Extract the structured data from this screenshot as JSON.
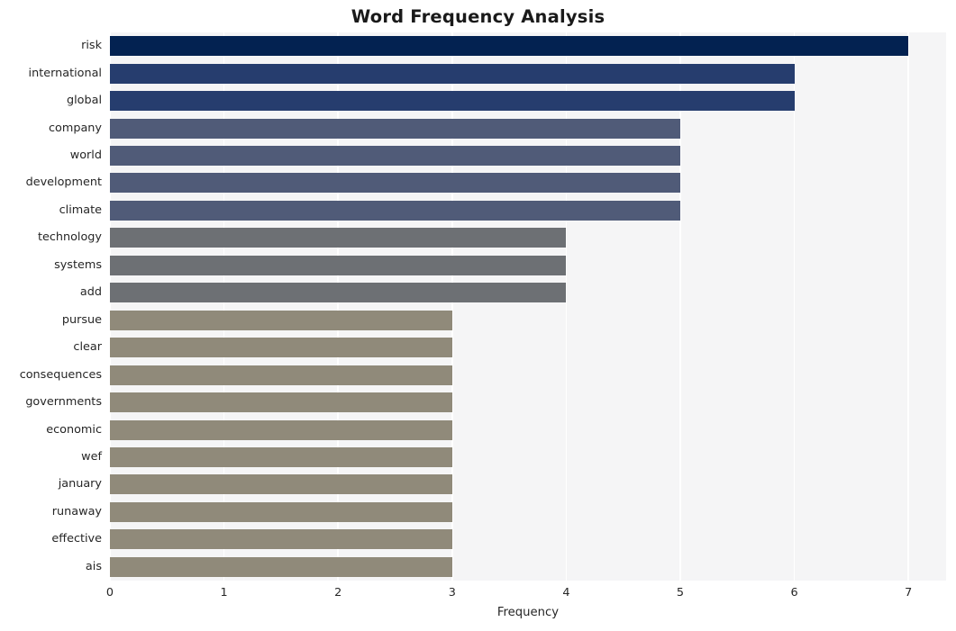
{
  "chart_data": {
    "type": "bar",
    "orientation": "horizontal",
    "title": "Word Frequency Analysis",
    "xlabel": "Frequency",
    "ylabel": "",
    "xlim": [
      0,
      7.33
    ],
    "xticks": [
      0,
      1,
      2,
      3,
      4,
      5,
      6,
      7
    ],
    "xtick_labels": [
      "0",
      "1",
      "2",
      "3",
      "4",
      "5",
      "6",
      "7"
    ],
    "grid": "vertical-white",
    "legend": "none",
    "categories": [
      "risk",
      "international",
      "global",
      "company",
      "world",
      "development",
      "climate",
      "technology",
      "systems",
      "add",
      "pursue",
      "clear",
      "consequences",
      "governments",
      "economic",
      "wef",
      "january",
      "runaway",
      "effective",
      "ais"
    ],
    "values": [
      7,
      6,
      6,
      5,
      5,
      5,
      5,
      4,
      4,
      4,
      3,
      3,
      3,
      3,
      3,
      3,
      3,
      3,
      3,
      3
    ],
    "bar_colors": [
      "#032251",
      "#263d6e",
      "#263d6e",
      "#505b78",
      "#505b78",
      "#505b78",
      "#505b78",
      "#6d7074",
      "#6d7074",
      "#6d7074",
      "#908a7a",
      "#908a7a",
      "#908a7a",
      "#908a7a",
      "#908a7a",
      "#908a7a",
      "#908a7a",
      "#908a7a",
      "#908a7a",
      "#908a7a"
    ]
  },
  "style": {
    "figure_background": "#ffffff",
    "plot_background": "#f5f5f6",
    "gridline_color": "#ffffff",
    "tick_label_color": "#262626",
    "title_color": "#1a1a1a"
  }
}
